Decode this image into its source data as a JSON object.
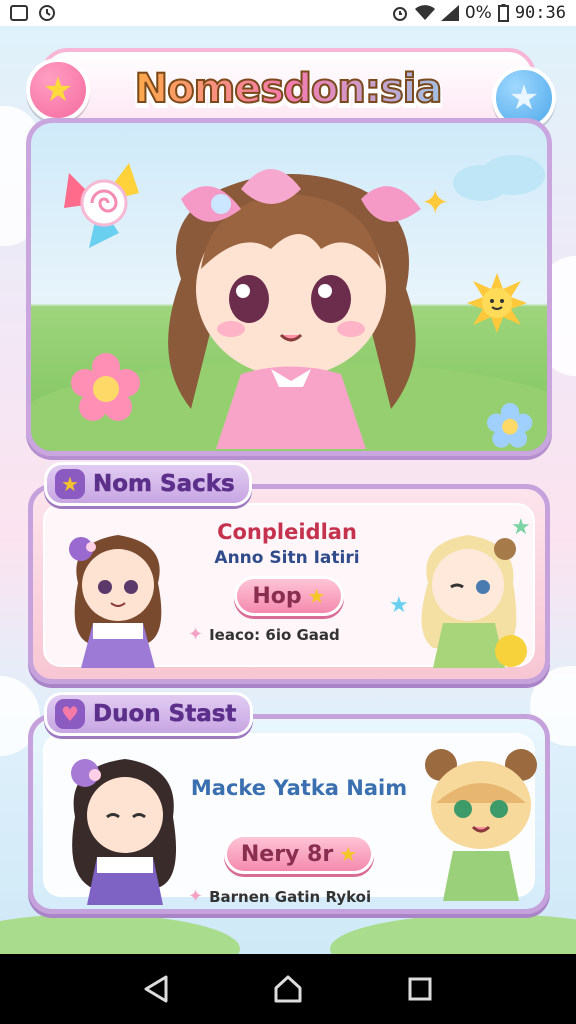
{
  "status_bar": {
    "time": "90:36",
    "battery_text": "0%",
    "icons": [
      "photo-icon",
      "clock-icon",
      "alarm-icon",
      "wifi-icon",
      "signal-icon",
      "battery-icon"
    ]
  },
  "header": {
    "title": "Nomesdon:sia",
    "left_button_icon": "star-icon",
    "right_button_icon": "star-icon"
  },
  "section1": {
    "tag_label": "Nom Sacks",
    "tag_icon": "star-icon",
    "title_line": "Conpleidlan",
    "subtitle_line": "Anno Sitn Iatiri",
    "button_label": "Hop",
    "footer_text": "Ieaco: 6io Gaad"
  },
  "section2": {
    "tag_label": "Duon Stast",
    "tag_icon": "heart-icon",
    "title_line": "Macke Yatka Naim",
    "button_label": "Nery 8r",
    "footer_text": "Barnen Gatin Rykoi"
  },
  "colors": {
    "accent_pink": "#f48aae",
    "accent_purple": "#c5a2dc",
    "title_orange": "#f3a62a",
    "star_yellow": "#f5c726"
  }
}
